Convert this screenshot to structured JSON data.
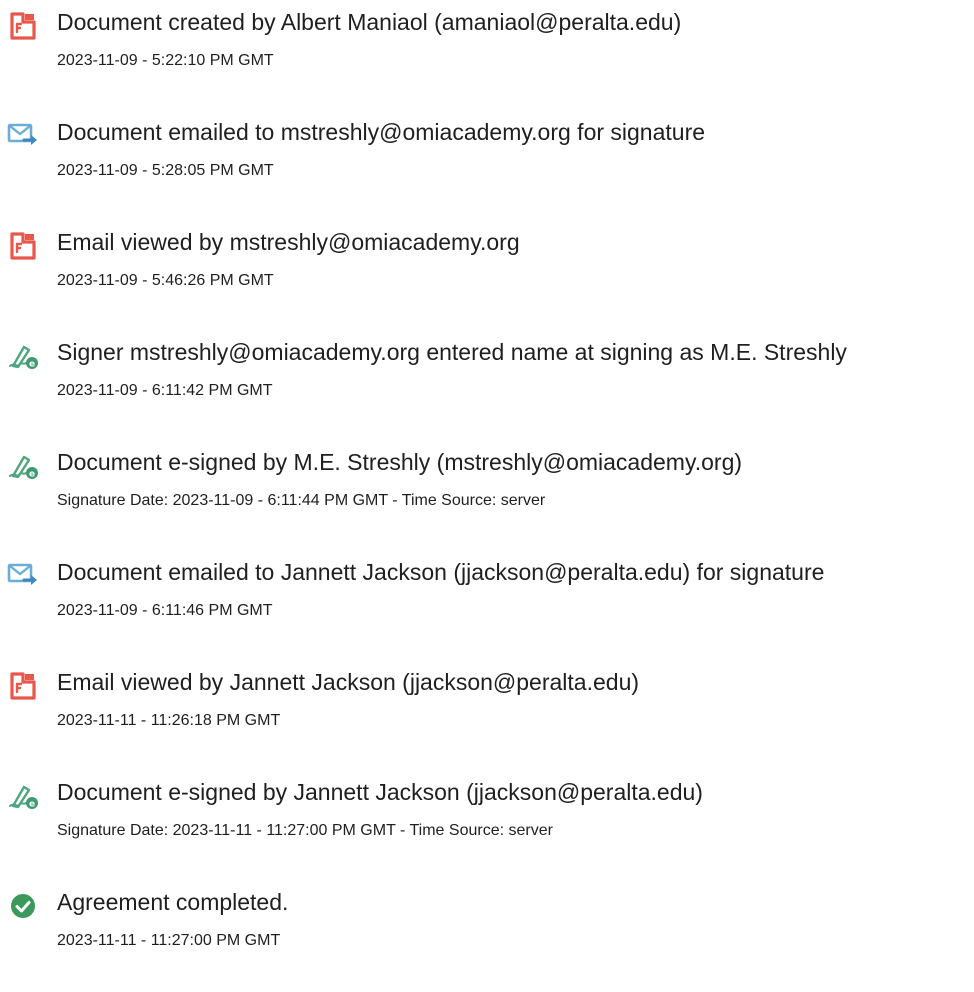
{
  "colors": {
    "doc_icon": "#e8584a",
    "email_icon": "#6aaed8",
    "sign_icon": "#4fa67d",
    "complete_icon": "#3a9a5b"
  },
  "events": [
    {
      "icon": "document-icon",
      "title": "Document created by Albert Maniaol (amaniaol@peralta.edu)",
      "sub": "2023-11-09 - 5:22:10 PM GMT"
    },
    {
      "icon": "email-send-icon",
      "title": "Document emailed to mstreshly@omiacademy.org for signature",
      "sub": "2023-11-09 - 5:28:05 PM GMT"
    },
    {
      "icon": "document-icon",
      "title": "Email viewed by mstreshly@omiacademy.org",
      "sub": "2023-11-09 - 5:46:26 PM GMT"
    },
    {
      "icon": "esign-icon",
      "title": "Signer mstreshly@omiacademy.org entered name at signing as M.E. Streshly",
      "sub": "2023-11-09 - 6:11:42 PM GMT"
    },
    {
      "icon": "esign-icon",
      "title": "Document e-signed by M.E. Streshly (mstreshly@omiacademy.org)",
      "sub": "Signature Date: 2023-11-09 - 6:11:44 PM GMT - Time Source: server"
    },
    {
      "icon": "email-send-icon",
      "title": "Document emailed to Jannett Jackson (jjackson@peralta.edu) for signature",
      "sub": "2023-11-09 - 6:11:46 PM GMT"
    },
    {
      "icon": "document-icon",
      "title": "Email viewed by Jannett Jackson (jjackson@peralta.edu)",
      "sub": "2023-11-11 - 11:26:18 PM GMT"
    },
    {
      "icon": "esign-icon",
      "title": "Document e-signed by Jannett Jackson (jjackson@peralta.edu)",
      "sub": "Signature Date: 2023-11-11 - 11:27:00 PM GMT - Time Source: server"
    },
    {
      "icon": "check-circle-icon",
      "title": "Agreement completed.",
      "sub": "2023-11-11 - 11:27:00 PM GMT"
    }
  ]
}
